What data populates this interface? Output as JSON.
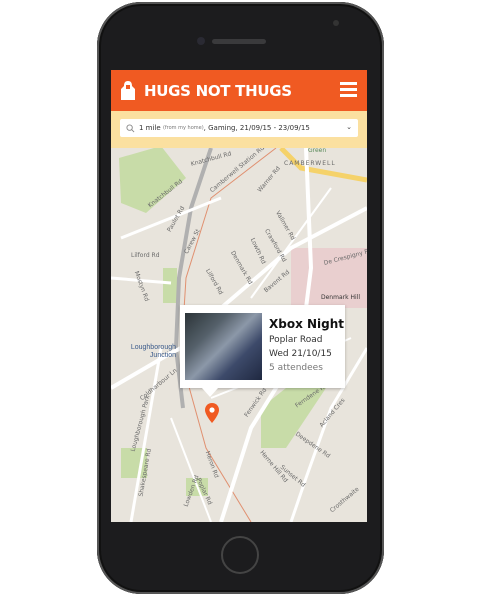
{
  "app": {
    "brand": "HUGS NOT THUGS",
    "menu_icon": "hamburger-icon",
    "logo_icon": "hoodie-icon"
  },
  "filter": {
    "distance": "1 mile",
    "distance_note": "(from my home)",
    "rest": ", Gaming, 21/09/15 - 23/09/15"
  },
  "colors": {
    "header": "#f05a22",
    "filter_bar": "#fbe0a0",
    "map_bg": "#e8e4dc",
    "park": "#c8dca8",
    "pin": "#f05a22"
  },
  "map": {
    "labels": [
      "Knatchbull Rd",
      "Knatchbull Rd",
      "Camberwell Station Rd",
      "CAMBERWELL",
      "Green",
      "Warner Rd",
      "Vallmer Rd",
      "Crawford Rd",
      "Lowth Rd",
      "Denmark Rd",
      "Paulet Rd",
      "Lilford Rd",
      "Lilford Rd",
      "Mostyn Rd",
      "Carew St",
      "De Crespigny Pk",
      "Bavent Rd",
      "Denmark Hill",
      "Loughborough Junction",
      "Coldharbour Ln",
      "Loughborough Park",
      "Shakespeare Rd",
      "Herne Hill Rd",
      "Poplar Rd",
      "Fenwick Rd",
      "Ferndene Rd",
      "Acland Cres",
      "Deepdene Rd",
      "Sunset Rd",
      "Heron Rd",
      "Lowden Rd",
      "Crosthwaite"
    ]
  },
  "event": {
    "title": "Xbox Night",
    "location": "Poplar Road",
    "date": "Wed  21/10/15",
    "attendees": "5 attendees"
  }
}
